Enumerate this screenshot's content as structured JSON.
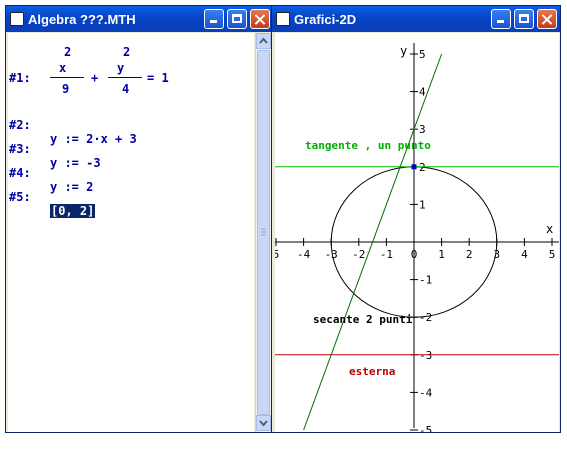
{
  "algebra_window": {
    "title": "Algebra  ???.MTH",
    "expressions": [
      {
        "label": "#1:",
        "exp_x": "2",
        "num_x": "x",
        "den_x": "9",
        "plus": "+",
        "exp_y": "2",
        "num_y": "y",
        "den_y": "4",
        "rhs": "= 1"
      },
      {
        "label": "#2:",
        "text": "y := 2·x + 3"
      },
      {
        "label": "#3:",
        "text": "y := -3"
      },
      {
        "label": "#4:",
        "text": "y := 2"
      },
      {
        "label": "#5:",
        "text": "[0, 2]",
        "selected": true
      }
    ]
  },
  "graph_window": {
    "title": "Grafici-2D",
    "axis": {
      "x_label": "x",
      "y_label": "y"
    },
    "x_ticks": [
      "5",
      "-4",
      "-3",
      "-2",
      "-1",
      "0",
      "1",
      "2",
      "3",
      "4",
      "5"
    ],
    "y_ticks": [
      "5",
      "4",
      "3",
      "2",
      "1",
      "-1",
      "-2",
      "-3",
      "-4",
      "-5"
    ],
    "annotations": {
      "tangent": "tangente , un punto",
      "secant": "secante 2 punti",
      "external": "esterna"
    },
    "colors": {
      "circle": "#000000",
      "secant_line": "#007000",
      "tangent_line": "#00c000",
      "external_line": "#c00000",
      "point": "#0000c0",
      "tangent_text": "#00b000",
      "external_text": "#c00000"
    }
  },
  "chart_data": {
    "type": "line",
    "x_range": [
      -5,
      5
    ],
    "y_range": [
      -5,
      5
    ],
    "curves": [
      {
        "name": "ellipse",
        "equation": "x^2/9 + y^2/4 = 1"
      },
      {
        "name": "secant",
        "equation": "y = 2x + 3"
      },
      {
        "name": "external",
        "equation": "y = -3"
      },
      {
        "name": "tangent",
        "equation": "y = 2"
      }
    ],
    "points": [
      {
        "x": 0,
        "y": 2
      }
    ]
  }
}
